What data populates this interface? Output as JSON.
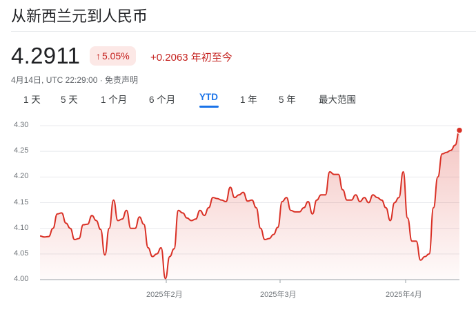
{
  "header": {
    "title": "从新西兰元到人民币"
  },
  "quote": {
    "price": "4.2911",
    "percent_change": "5.05%",
    "change_text": "+0.2063 年初至今",
    "timestamp": "4月14日, UTC 22:29:00 · 免责声明",
    "trend_color": "#c5221f",
    "badge_bg": "#fce8e6",
    "arrow_icon": "arrow-up-icon"
  },
  "tabs": [
    {
      "label": "1 天",
      "active": false
    },
    {
      "label": "5 天",
      "active": false
    },
    {
      "label": "1 个月",
      "active": false
    },
    {
      "label": "6 个月",
      "active": false
    },
    {
      "label": "YTD",
      "active": true
    },
    {
      "label": "1 年",
      "active": false
    },
    {
      "label": "5 年",
      "active": false
    },
    {
      "label": "最大范围",
      "active": false
    }
  ],
  "chart_data": {
    "type": "area",
    "title": "",
    "xlabel": "",
    "ylabel": "",
    "ylim": [
      4.0,
      4.3
    ],
    "yticks": [
      "4.30",
      "4.25",
      "4.20",
      "4.15",
      "4.10",
      "4.05",
      "4.00"
    ],
    "xtick_labels": [
      "2025年2月",
      "2025年3月",
      "2025年4月"
    ],
    "grid": "horizontal",
    "line_color": "#d93025",
    "series": [
      {
        "values": [
          4.085,
          4.083,
          4.084,
          4.1,
          4.128,
          4.13,
          4.11,
          4.1,
          4.078,
          4.08,
          4.107,
          4.108,
          4.125,
          4.115,
          4.098,
          4.048,
          4.1,
          4.155,
          4.115,
          4.118,
          4.135,
          4.1,
          4.1,
          4.122,
          4.108,
          4.062,
          4.045,
          4.05,
          4.062,
          4.002,
          4.045,
          4.06,
          4.135,
          4.13,
          4.12,
          4.115,
          4.118,
          4.135,
          4.125,
          4.14,
          4.16,
          4.158,
          4.155,
          4.152,
          4.18,
          4.16,
          4.165,
          4.17,
          4.153,
          4.155,
          4.14,
          4.1,
          4.078,
          4.08,
          4.088,
          4.102,
          4.152,
          4.16,
          4.135,
          4.132,
          4.132,
          4.14,
          4.152,
          4.128,
          4.155,
          4.165,
          4.165,
          4.21,
          4.205,
          4.205,
          4.175,
          4.155,
          4.155,
          4.165,
          4.152,
          4.16,
          4.15,
          4.165,
          4.16,
          4.155,
          4.14,
          4.115,
          4.15,
          4.16,
          4.21,
          4.12,
          4.075,
          4.075,
          4.038,
          4.045,
          4.05,
          4.14,
          4.2,
          4.245,
          4.248,
          4.252,
          4.262,
          4.291
        ]
      }
    ]
  }
}
